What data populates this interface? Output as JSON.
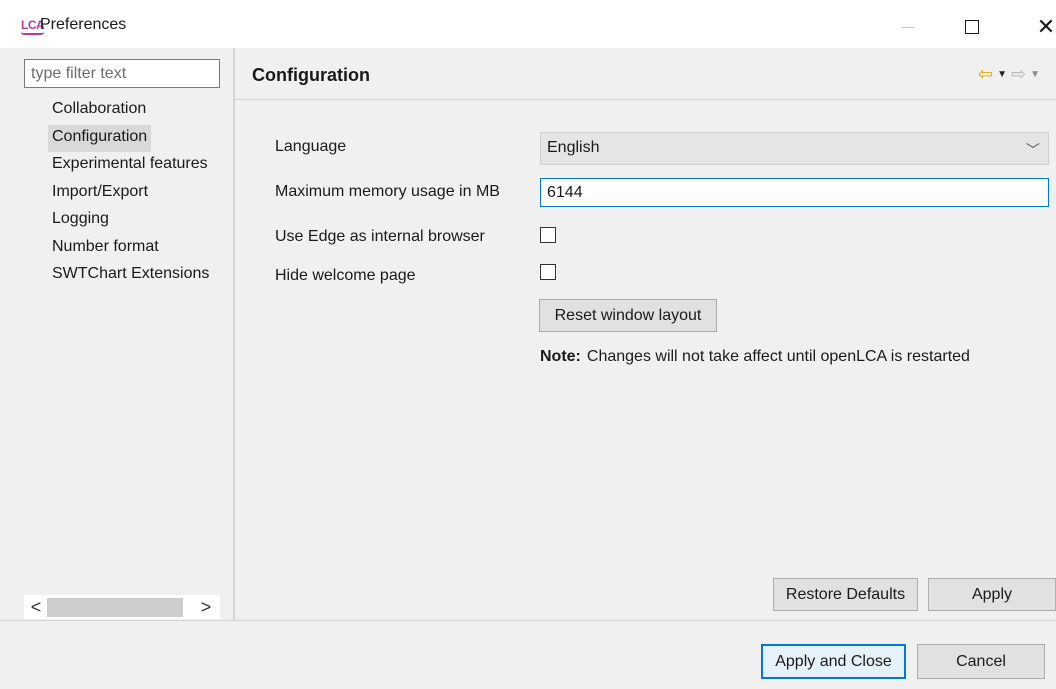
{
  "window": {
    "logo": "LCA",
    "title": "Preferences",
    "minimize_icon": "minimize-icon",
    "maximize_icon": "maximize-icon",
    "close_icon": "close-icon"
  },
  "sidebar": {
    "filter_placeholder": "type filter text",
    "selected": "Configuration",
    "items": [
      {
        "label": "Collaboration"
      },
      {
        "label": "Configuration"
      },
      {
        "label": "Experimental features"
      },
      {
        "label": "Import/Export"
      },
      {
        "label": "Logging"
      },
      {
        "label": "Number format"
      },
      {
        "label": "SWTChart Extensions"
      }
    ],
    "scroll_left": "<",
    "scroll_right": ">"
  },
  "page": {
    "title": "Configuration",
    "back_icon": "back-arrow-icon",
    "forward_icon": "forward-arrow-icon",
    "language_label": "Language",
    "language_value": "English",
    "memory_label": "Maximum memory usage in MB",
    "memory_value": "6144",
    "edge_label": "Use Edge as internal browser",
    "edge_checked": false,
    "welcome_label": "Hide welcome page",
    "welcome_checked": false,
    "reset_button": "Reset window layout",
    "note_bold": "Note:",
    "note_text": "Changes will not take affect until openLCA is restarted",
    "restore_defaults_button": "Restore Defaults",
    "apply_button": "Apply"
  },
  "footer": {
    "apply_close_button": "Apply and Close",
    "cancel_button": "Cancel"
  },
  "colors": {
    "accent": "#0078d7",
    "logo": "#c0399a",
    "back_arrow": "#e0a800"
  }
}
